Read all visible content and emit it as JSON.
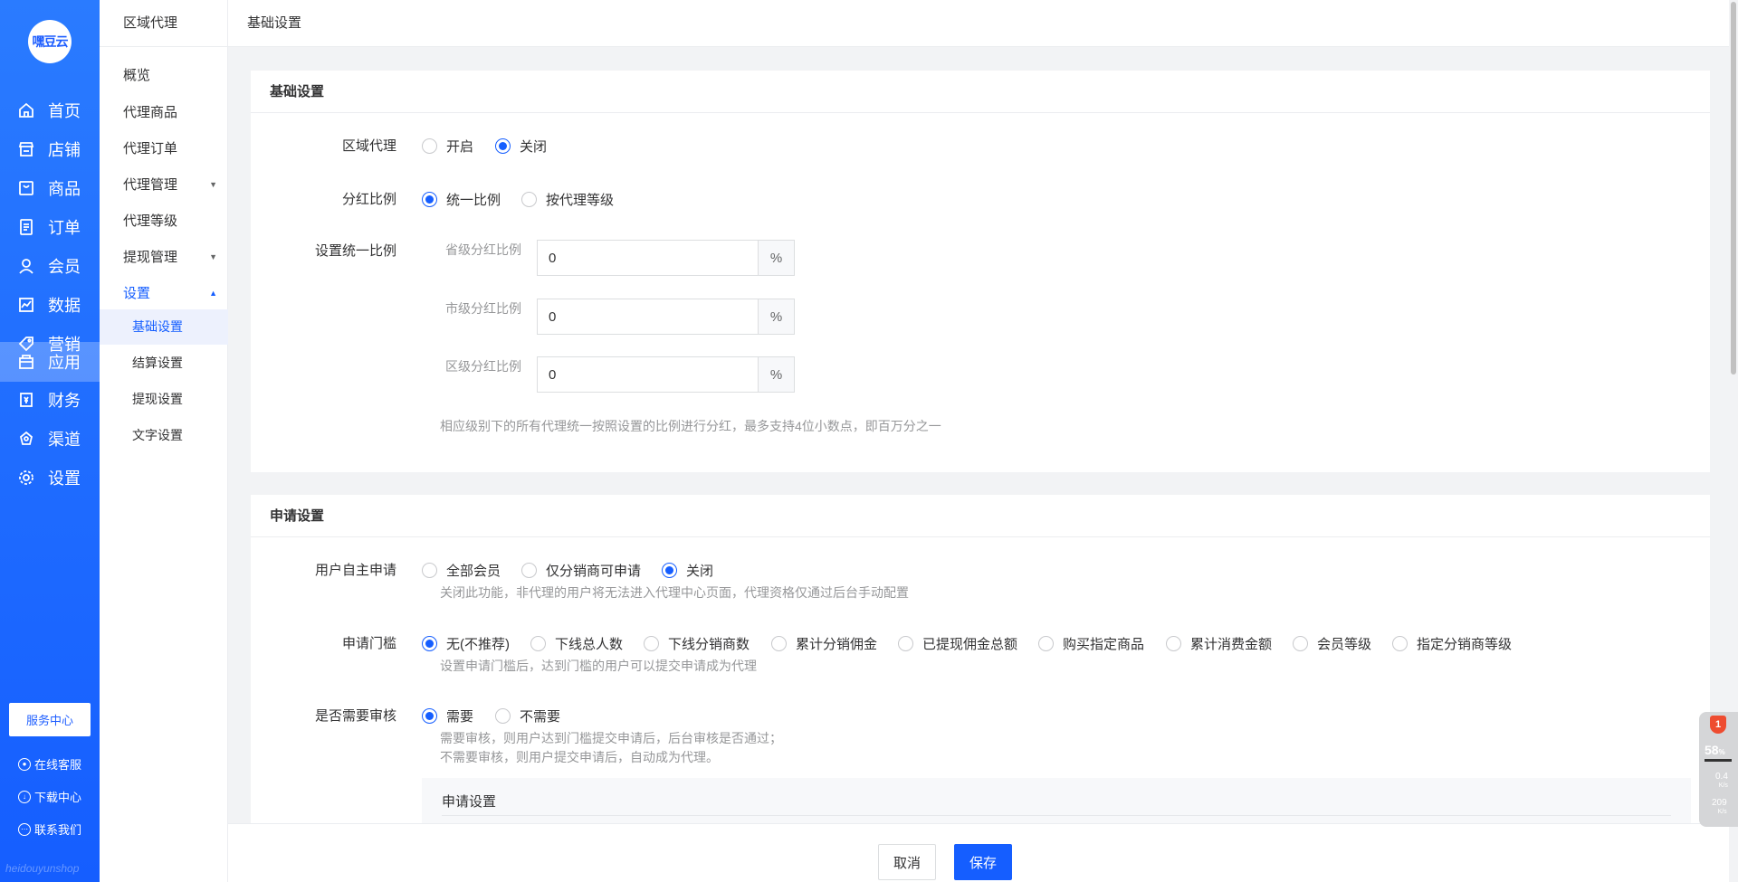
{
  "brand": {
    "logo_text": "嘿豆云",
    "watermark": "heidouyunshop"
  },
  "sidebar": {
    "items": [
      {
        "label": "首页",
        "icon": "home-icon"
      },
      {
        "label": "店铺",
        "icon": "store-icon"
      },
      {
        "label": "商品",
        "icon": "goods-icon"
      },
      {
        "label": "订单",
        "icon": "order-icon"
      },
      {
        "label": "会员",
        "icon": "member-icon"
      },
      {
        "label": "数据",
        "icon": "chart-icon"
      },
      {
        "label": "营销",
        "icon": "tag-icon"
      },
      {
        "label": "应用",
        "icon": "app-icon",
        "active": true
      },
      {
        "label": "财务",
        "icon": "finance-icon"
      },
      {
        "label": "渠道",
        "icon": "channel-icon"
      },
      {
        "label": "设置",
        "icon": "gear-icon"
      }
    ],
    "service_center": "服务中心",
    "online_service": "在线客服",
    "download_center": "下载中心",
    "contact_us": "联系我们"
  },
  "submenu": {
    "title": "区域代理",
    "items": [
      {
        "label": "概览"
      },
      {
        "label": "代理商品"
      },
      {
        "label": "代理订单"
      },
      {
        "label": "代理管理"
      },
      {
        "label": "代理等级"
      },
      {
        "label": "提现管理"
      },
      {
        "label": "设置"
      }
    ],
    "settings_children": [
      {
        "label": "基础设置",
        "active": true
      },
      {
        "label": "结算设置"
      },
      {
        "label": "提现设置"
      },
      {
        "label": "文字设置"
      }
    ]
  },
  "header": {
    "breadcrumb": "基础设置"
  },
  "basic": {
    "title": "基础设置",
    "region_agent": {
      "label": "区域代理",
      "options": [
        "开启",
        "关闭"
      ],
      "selected": "关闭"
    },
    "bonus_ratio": {
      "label": "分红比例",
      "options": [
        "统一比例",
        "按代理等级"
      ],
      "selected": "统一比例"
    },
    "unified": {
      "label": "设置统一比例",
      "province": {
        "label": "省级分红比例",
        "value": "0",
        "unit": "%"
      },
      "city": {
        "label": "市级分红比例",
        "value": "0",
        "unit": "%"
      },
      "district": {
        "label": "区级分红比例",
        "value": "0",
        "unit": "%"
      },
      "help": "相应级别下的所有代理统一按照设置的比例进行分红，最多支持4位小数点，即百万分之一"
    }
  },
  "apply": {
    "title": "申请设置",
    "self_apply": {
      "label": "用户自主申请",
      "options": [
        "全部会员",
        "仅分销商可申请",
        "关闭"
      ],
      "selected": "关闭",
      "help": "关闭此功能，非代理的用户将无法进入代理中心页面，代理资格仅通过后台手动配置"
    },
    "threshold": {
      "label": "申请门槛",
      "options": [
        "无(不推荐)",
        "下线总人数",
        "下线分销商数",
        "累计分销佣金",
        "已提现佣金总额",
        "购买指定商品",
        "累计消费金额",
        "会员等级",
        "指定分销商等级"
      ],
      "selected": "无(不推荐)",
      "help": "设置申请门槛后，达到门槛的用户可以提交申请成为代理"
    },
    "review": {
      "label": "是否需要审核",
      "options": [
        "需要",
        "不需要"
      ],
      "selected": "需要",
      "help1": "需要审核，则用户达到门槛提交申请后，后台审核是否通过；",
      "help2": "不需要审核，则用户提交申请后，自动成为代理。"
    },
    "inner_title": "申请设置"
  },
  "footer": {
    "cancel": "取消",
    "save": "保存"
  },
  "widget": {
    "badge": "1",
    "cpu": "58",
    "cpu_unit": "%",
    "up": "0.4",
    "up_unit": "K/s",
    "down": "209",
    "down_unit": "K/s"
  },
  "colors": {
    "primary": "#155eff",
    "sidebar": "#1e66ff",
    "danger": "#ee4c30"
  }
}
